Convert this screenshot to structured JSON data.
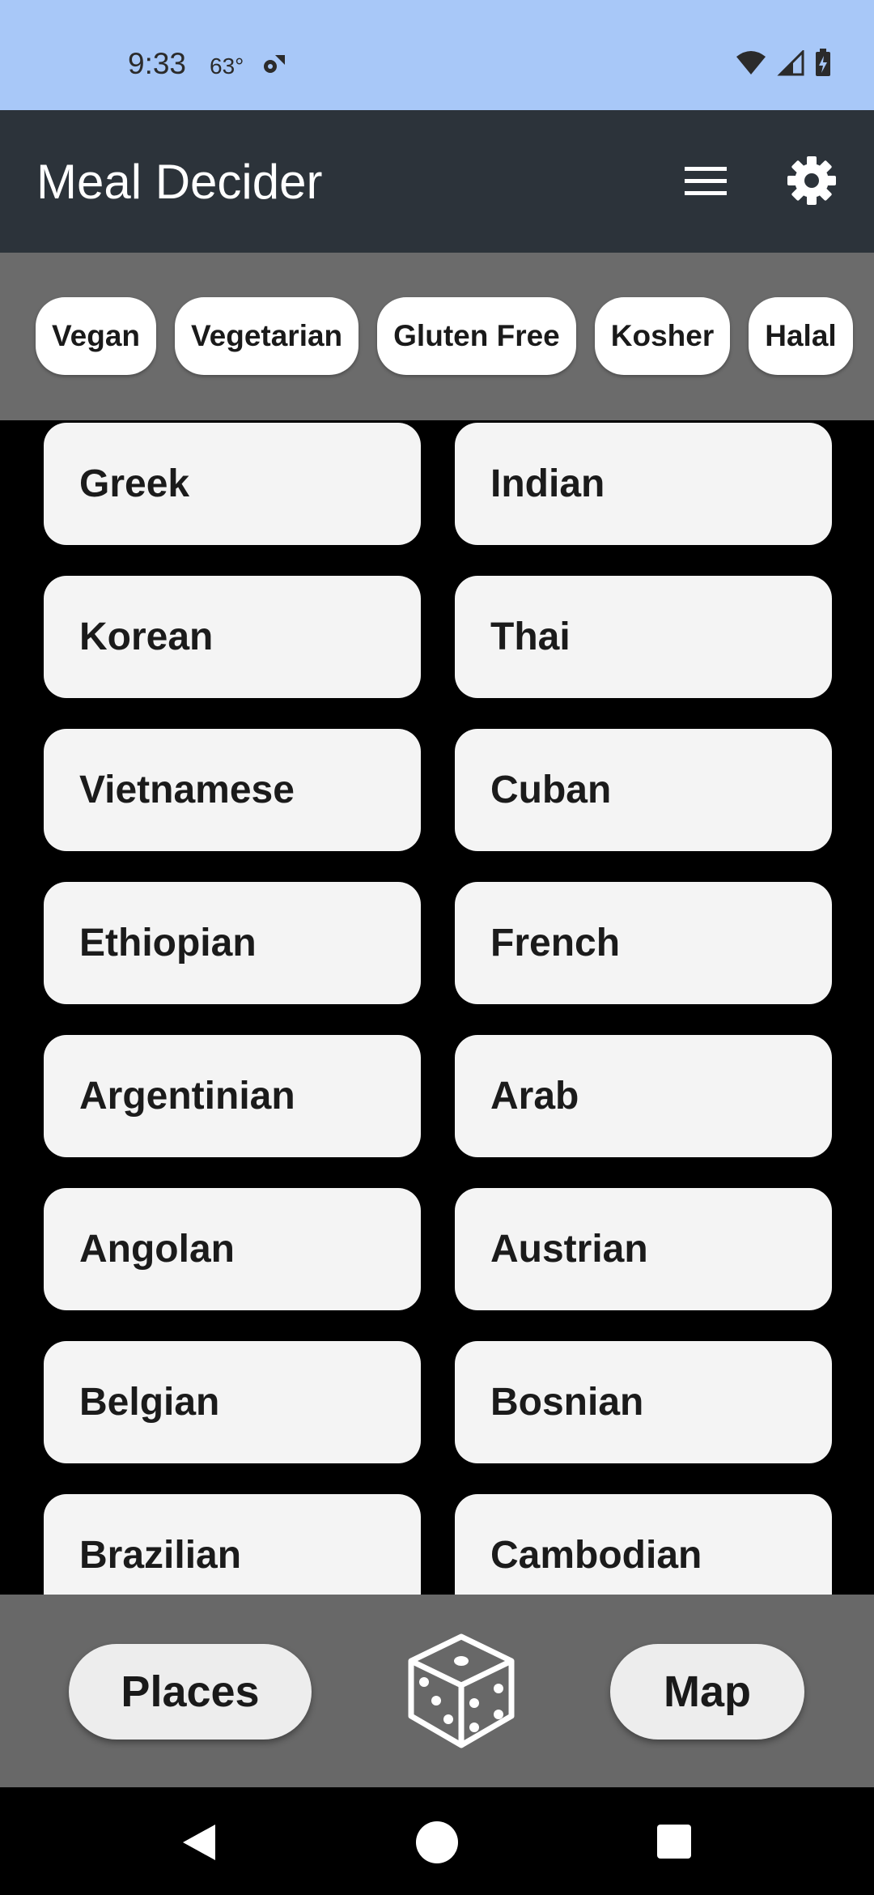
{
  "status_bar": {
    "time": "9:33",
    "temperature": "63°",
    "icons": [
      "fan-sync-icon",
      "wifi-icon",
      "cell-signal-icon",
      "battery-charging-icon"
    ]
  },
  "app_bar": {
    "title": "Meal Decider",
    "icons": [
      "menu-icon",
      "gear-icon"
    ]
  },
  "filters": [
    "Vegan",
    "Vegetarian",
    "Gluten Free",
    "Kosher",
    "Halal"
  ],
  "cuisines": [
    "Greek",
    "Indian",
    "Korean",
    "Thai",
    "Vietnamese",
    "Cuban",
    "Ethiopian",
    "French",
    "Argentinian",
    "Arab",
    "Angolan",
    "Austrian",
    "Belgian",
    "Bosnian",
    "Brazilian",
    "Cambodian"
  ],
  "bottom_bar": {
    "places_label": "Places",
    "map_label": "Map",
    "center_icon": "dice-icon"
  },
  "nav_bar": {
    "icons": [
      "back-icon",
      "home-icon",
      "recents-icon"
    ]
  },
  "colors": {
    "status_bar": "#a8c8f8",
    "app_bar": "#2c333a",
    "chip_bar": "#6b6b6b",
    "background": "#000000",
    "card": "#f4f4f4",
    "bottom_bar": "#686868"
  }
}
